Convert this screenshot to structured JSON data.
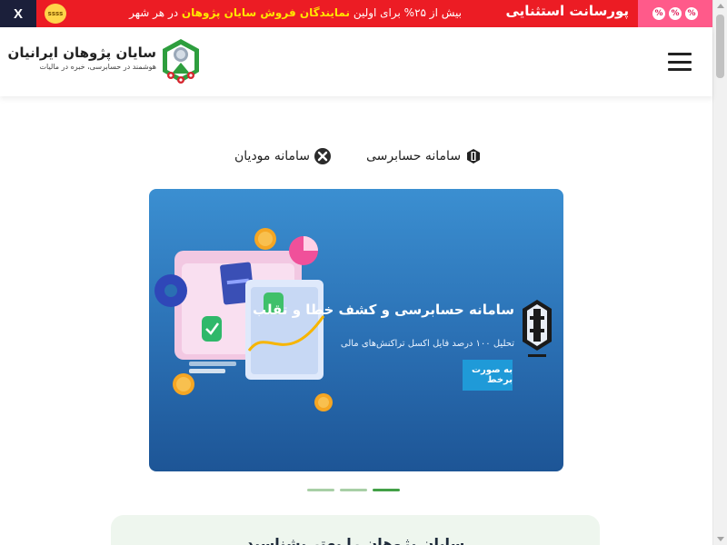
{
  "promo": {
    "title": "پورسانت استثنایی",
    "text_prefix": "بیش از ۲۵% برای اولین",
    "text_highlight": "نمایندگان فروش سایان پژوهان",
    "text_suffix": "در هر شهر",
    "close_label": "X",
    "badge_symbols": [
      "%",
      "%",
      "%"
    ],
    "face_text": "ssss"
  },
  "header": {
    "brand_name": "سایان پژوهان ایرانیان",
    "brand_tagline": "هوشمند در حسابرسی، خبره در مالیات",
    "menu_icon": "hamburger-icon"
  },
  "tabs": [
    {
      "label": "سامانه حسابرسی",
      "icon": "audit-icon"
    },
    {
      "label": "سامانه مودیان",
      "icon": "x-icon"
    }
  ],
  "banner": {
    "title": "سامانه حسابرسی و کشف خطا و تقلب",
    "subtitle": "تحلیل ۱۰۰ درصد فایل اکسل تراکنش‌های مالی",
    "cta": "به صورت برخط"
  },
  "slider": {
    "count": 3,
    "active_index": 3
  },
  "intro": {
    "title": "سایان پژوهان را بهتر بشناسید"
  },
  "colors": {
    "promo_bg": "#ec1c24",
    "close_bg": "#1b1f3a",
    "highlight": "#ffe600",
    "banner_blue": "#2a6fb3",
    "dot_active": "#43a047",
    "card_bg": "#eef6ee"
  }
}
